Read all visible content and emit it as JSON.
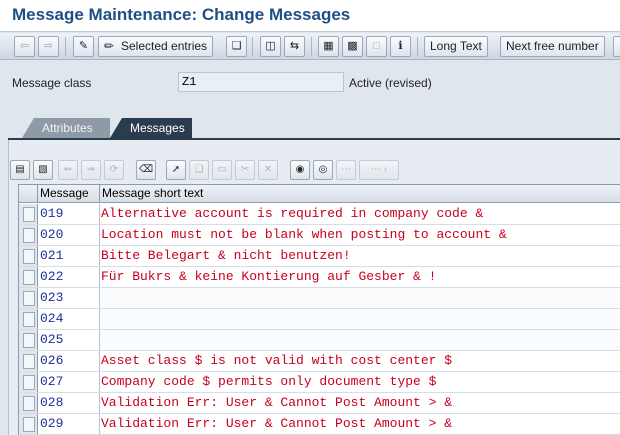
{
  "window": {
    "title": "Message Maintenance: Change Messages"
  },
  "toolbar": {
    "selected_entries": "Selected entries",
    "long_text": "Long Text",
    "next_free_number": "Next free number"
  },
  "header": {
    "message_class_label": "Message class",
    "message_class_value": "Z1",
    "status": "Active (revised)"
  },
  "tabs": [
    {
      "label": "Attributes",
      "active": false
    },
    {
      "label": "Messages",
      "active": true
    }
  ],
  "table": {
    "columns": [
      "Message",
      "Message short text"
    ],
    "rows": [
      {
        "number": "019",
        "text": "Alternative account is required in company code &"
      },
      {
        "number": "020",
        "text": "Location must not be blank when posting to account &"
      },
      {
        "number": "021",
        "text": "Bitte Belegart & nicht benutzen!"
      },
      {
        "number": "022",
        "text": "Für Bukrs & keine Kontierung auf Gesber & !"
      },
      {
        "number": "023",
        "text": ""
      },
      {
        "number": "024",
        "text": ""
      },
      {
        "number": "025",
        "text": ""
      },
      {
        "number": "026",
        "text": "Asset class $ is not valid with cost center $"
      },
      {
        "number": "027",
        "text": "Company code $ permits only document type $"
      },
      {
        "number": "028",
        "text": "Validation Err: User & Cannot Post Amount > &"
      },
      {
        "number": "029",
        "text": "Validation Err: User & Cannot Post Amount > &"
      }
    ]
  },
  "colors": {
    "title": "#1f4f86",
    "message_number": "#1a2f9a",
    "message_text": "#c8001e",
    "active_tab": "#2b3c4e"
  }
}
